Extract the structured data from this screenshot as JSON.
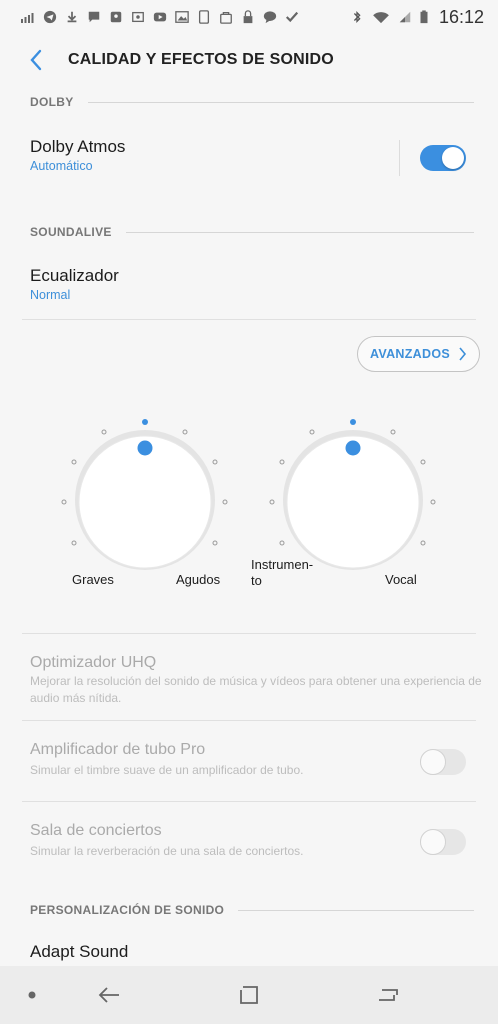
{
  "status": {
    "time": "16:12",
    "left_icons": [
      "signal-bars-icon",
      "telegram-icon",
      "download-icon",
      "message-icon",
      "maps-icon",
      "photo-icon",
      "youtube-icon",
      "gallery-icon",
      "tablet-icon",
      "shopping-bag-icon",
      "lock-icon",
      "chat-bubble-icon",
      "check-icon"
    ],
    "right_icons": [
      "bluetooth-icon",
      "wifi-icon",
      "cell-signal-icon",
      "battery-icon"
    ]
  },
  "header": {
    "title": "CALIDAD Y EFECTOS DE SONIDO"
  },
  "sections": {
    "dolby": "DOLBY",
    "soundalive": "SOUNDALIVE",
    "personalizacion": "PERSONALIZACIÓN DE SONIDO"
  },
  "dolby_atmos": {
    "title": "Dolby Atmos",
    "subtitle": "Automático",
    "enabled": true
  },
  "ecualizador": {
    "title": "Ecualizador",
    "subtitle": "Normal"
  },
  "advanced_button": {
    "label": "AVANZADOS"
  },
  "knobs": {
    "left": {
      "min_label": "Graves",
      "max_label": "Agudos"
    },
    "right": {
      "min_label_line1": "Instrumen-",
      "min_label_line2": "to",
      "max_label": "Vocal"
    }
  },
  "uhq": {
    "title": "Optimizador UHQ",
    "desc_line1": "Mejorar la resolución del sonido de música y vídeos para obtener una experiencia de",
    "desc_line2": "audio más nítida."
  },
  "tube_amp": {
    "title": "Amplificador de tubo Pro",
    "desc": "Simular el timbre suave de un amplificador de tubo.",
    "enabled": false
  },
  "concert_hall": {
    "title": "Sala de conciertos",
    "desc": "Simular la reverberación de una sala de conciertos.",
    "enabled": false
  },
  "adapt_sound": {
    "title": "Adapt Sound"
  },
  "colors": {
    "accent": "#3b8fe0",
    "background": "#f6f6f6",
    "disabled_text": "#aaaaaa"
  }
}
